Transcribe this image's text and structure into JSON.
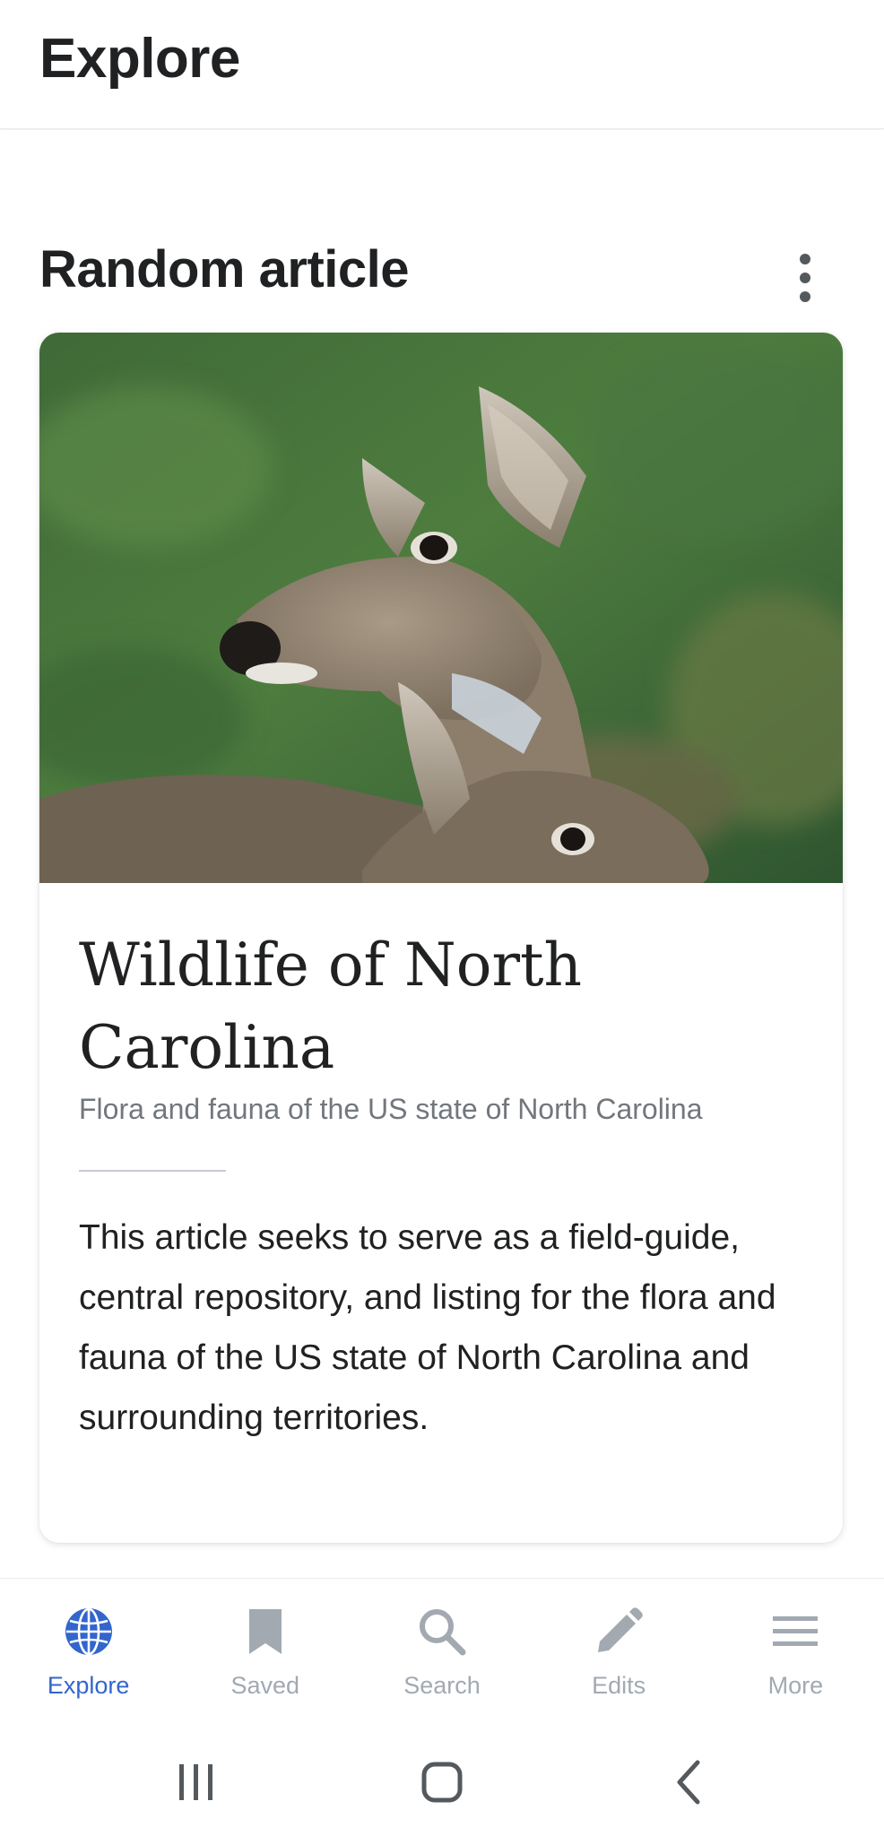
{
  "app_bar": {
    "title": "Explore"
  },
  "feed": {
    "card_header": {
      "title": "Random article",
      "overflow_icon": "more-vertical-icon"
    },
    "card": {
      "image_subject": "white-tailed deer photo",
      "title": "Wildlife of North Carolina",
      "description": "Flora and fauna of the US state of North Carolina",
      "extract": "This article seeks to serve as a field-guide, central repository, and listing for the flora and fauna of the US state of North Carolina and surrounding territories."
    }
  },
  "bottom_nav": {
    "items": [
      {
        "label": "Explore",
        "icon": "globe-icon",
        "active": true
      },
      {
        "label": "Saved",
        "icon": "bookmark-icon",
        "active": false
      },
      {
        "label": "Search",
        "icon": "search-icon",
        "active": false
      },
      {
        "label": "Edits",
        "icon": "pencil-icon",
        "active": false
      },
      {
        "label": "More",
        "icon": "menu-icon",
        "active": false
      }
    ]
  },
  "system_nav": {
    "buttons": [
      "recent-apps-icon",
      "home-icon",
      "back-icon"
    ]
  },
  "colors": {
    "accent": "#3366cc",
    "inactive": "#a2a9b1",
    "text": "#202122",
    "secondary_text": "#72777d"
  }
}
